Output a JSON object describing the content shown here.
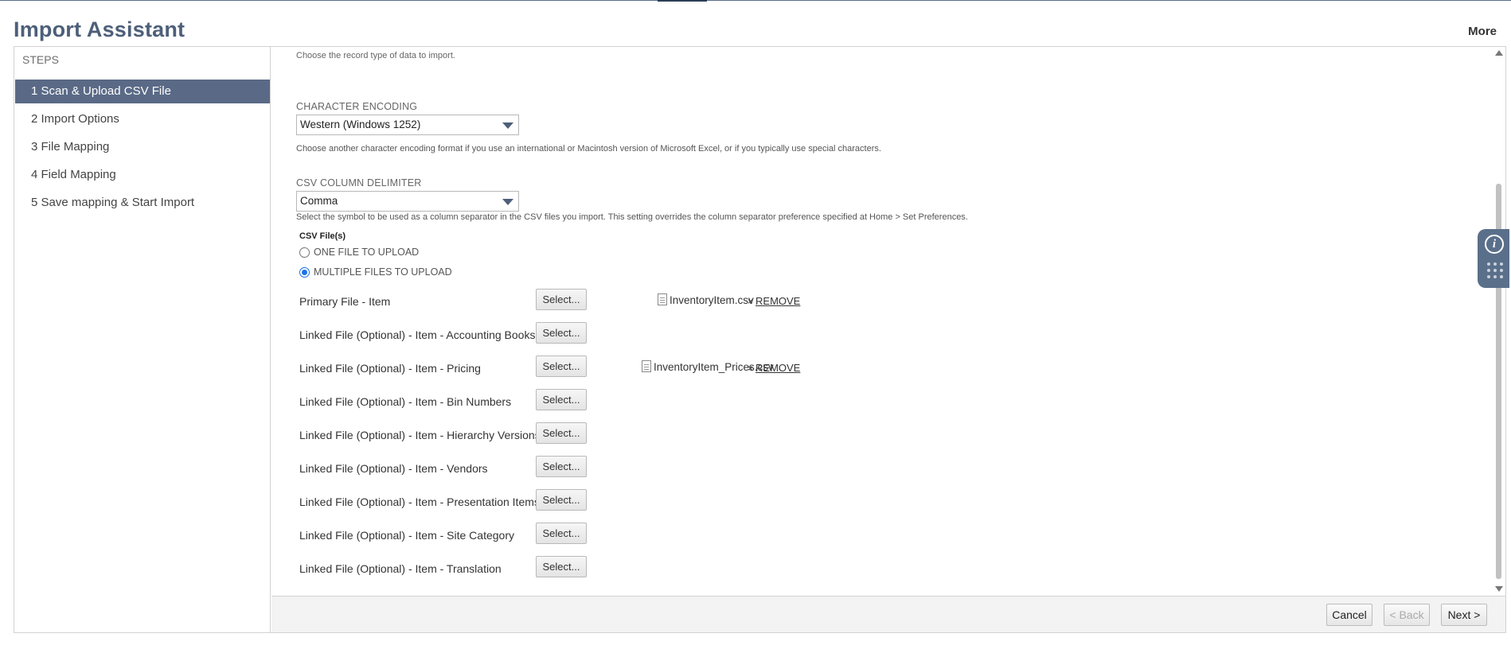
{
  "header": {
    "title": "Import Assistant",
    "more_label": "More"
  },
  "sidebar": {
    "title": "STEPS",
    "steps": [
      {
        "label": "1 Scan & Upload CSV File",
        "active": true
      },
      {
        "label": "2 Import Options",
        "active": false
      },
      {
        "label": "3 File Mapping",
        "active": false
      },
      {
        "label": "4 Field Mapping",
        "active": false
      },
      {
        "label": "5 Save mapping & Start Import",
        "active": false
      }
    ]
  },
  "main": {
    "record_type_hint": "Choose the record type of data to import.",
    "encoding": {
      "label": "CHARACTER ENCODING",
      "value": "Western (Windows 1252)",
      "help": "Choose another character encoding format if you use an international or Macintosh version of Microsoft Excel, or if you typically use special characters."
    },
    "delimiter": {
      "label": "CSV COLUMN DELIMITER",
      "value": "Comma",
      "help": "Select the symbol to be used as a column separator in the CSV files you import. This setting overrides the column separator preference specified at Home > Set Preferences."
    },
    "csv_files_label": "CSV File(s)",
    "upload_options": [
      {
        "label": "ONE FILE TO UPLOAD",
        "checked": false
      },
      {
        "label": "MULTIPLE FILES TO UPLOAD",
        "checked": true
      }
    ],
    "select_label": "Select...",
    "remove_label": "REMOVE",
    "files": [
      {
        "label": "Primary File - Item",
        "file": "InventoryItem.csv"
      },
      {
        "label": "Linked File (Optional) - Item - Accounting Books",
        "file": ""
      },
      {
        "label": "Linked File (Optional) - Item - Pricing",
        "file": "InventoryItem_Prices.csv"
      },
      {
        "label": "Linked File (Optional) - Item - Bin Numbers",
        "file": ""
      },
      {
        "label": "Linked File (Optional) - Item - Hierarchy Versions",
        "file": ""
      },
      {
        "label": "Linked File (Optional) - Item - Vendors",
        "file": ""
      },
      {
        "label": "Linked File (Optional) - Item - Presentation Items",
        "file": ""
      },
      {
        "label": "Linked File (Optional) - Item - Site Category",
        "file": ""
      },
      {
        "label": "Linked File (Optional) - Item - Translation",
        "file": ""
      }
    ]
  },
  "footer": {
    "cancel_label": "Cancel",
    "back_label": "< Back",
    "next_label": "Next >"
  },
  "widget": {
    "info_glyph": "i"
  },
  "colors": {
    "accent": "#5a6a86",
    "title": "#4d5f79"
  }
}
